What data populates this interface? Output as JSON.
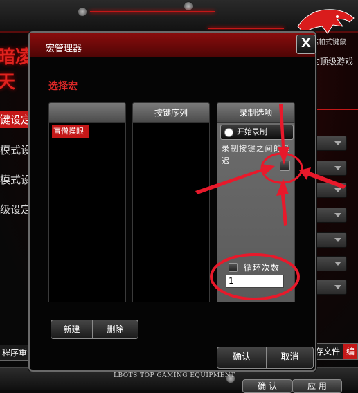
{
  "background": {
    "sidebar": [
      {
        "label": "键设定",
        "active": true
      },
      {
        "label": "模式设",
        "active": false
      },
      {
        "label": "模式设定",
        "active": false
      },
      {
        "label": "级设定",
        "active": false
      }
    ],
    "title_line1": "暗凌",
    "title_line2": "天",
    "logo_caption": "达帕式键鼠",
    "slogan": "豹顶级游戏",
    "tab_profile": "存文件",
    "tab_edit": "编",
    "reset_label": "程序重置",
    "footer_text": "LBOTS TOP GAMING EQUIPMENT",
    "bottom_confirm": "确 认",
    "bottom_apply": "应 用"
  },
  "dialog": {
    "title": "宏管理器",
    "close_label": "X",
    "section_label": "选择宏",
    "macro_list": {
      "header": "",
      "items": [
        "盲僧摸眼"
      ]
    },
    "key_sequence": {
      "header": "按键序列"
    },
    "record_options": {
      "header": "录制选项",
      "start_record": "开始录制",
      "delay_label": "录制按键之间的延迟",
      "loop_label": "循环次数",
      "loop_value": "1"
    },
    "buttons": {
      "new": "新建",
      "delete": "删除",
      "ok": "确认",
      "cancel": "取消"
    }
  },
  "colors": {
    "accent": "#c41818",
    "annotation": "#e8192b",
    "titlebar": "#7a0b0b"
  }
}
